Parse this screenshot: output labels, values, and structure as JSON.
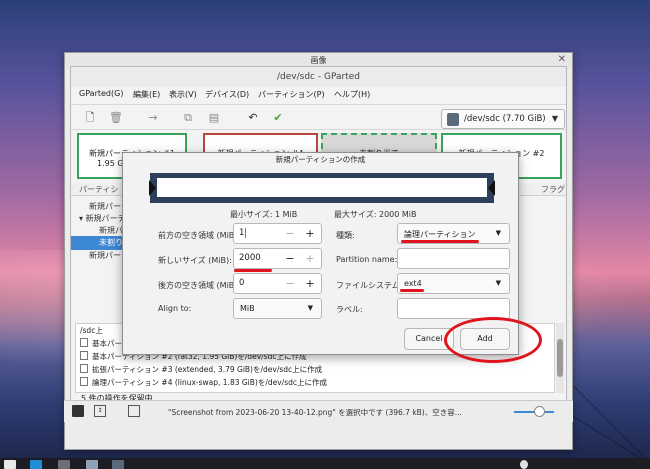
{
  "image_viewer": {
    "title": "画像"
  },
  "gparted": {
    "title": "/dev/sdc - GParted",
    "menu": [
      "GParted(G)",
      "編集(E)",
      "表示(V)",
      "デバイス(D)",
      "パーティション(P)",
      "ヘルプ(H)"
    ],
    "device": "/dev/sdc (7.70 GiB)",
    "partitions": [
      {
        "label": "新規パーティション #1",
        "size": "1.95 G"
      },
      {
        "label": "新規パーティション #4"
      },
      {
        "label": "未割り当て"
      },
      {
        "label": "新規パーティション #2"
      }
    ],
    "column_partition": "パーティシ",
    "column_flags": "フラグ",
    "tree_rows": [
      "新規パーティ",
      "新規パーティ",
      "新規パ",
      "未割り",
      "新規パーティ"
    ],
    "operations": [
      "/sdc上",
      "基本パーティ",
      "基本パーティション #2 (fat32, 1.95 GiB)を/dev/sdc上に作成",
      "拡張パーティション #3 (extended, 3.79 GiB)を/dev/sdc上に作成",
      "論理パーティション #4 (linux-swap, 1.83 GiB)を/dev/sdc上に作成"
    ],
    "status": "5 件の操作を保留中"
  },
  "dialog": {
    "title": "新規パーティションの作成",
    "min_size": "最小サイズ: 1 MiB",
    "max_size": "最大サイズ: 2000 MiB",
    "free_before_label": "前方の空き領域 (MiB):",
    "free_before_value": "1",
    "new_size_label": "新しいサイズ (MiB):",
    "new_size_value": "2000",
    "free_after_label": "後方の空き領域 (MiB):",
    "free_after_value": "0",
    "align_label": "Align to:",
    "align_value": "MiB",
    "type_label": "種類:",
    "type_value": "論理パーティション",
    "partition_name_label": "Partition name:",
    "filesystem_label": "ファイルシステム:",
    "filesystem_value": "ext4",
    "label_label": "ラベル:",
    "cancel": "Cancel",
    "add": "Add"
  },
  "footer": {
    "info": "\"Screenshot from 2023-06-20 13-40-12.png\" を選択中です (396.7 kB)、空き容..."
  },
  "colors": {
    "annotation": "#e0141e",
    "partition_border": "#3aa35b",
    "bar_frame": "#2d3f5a"
  }
}
